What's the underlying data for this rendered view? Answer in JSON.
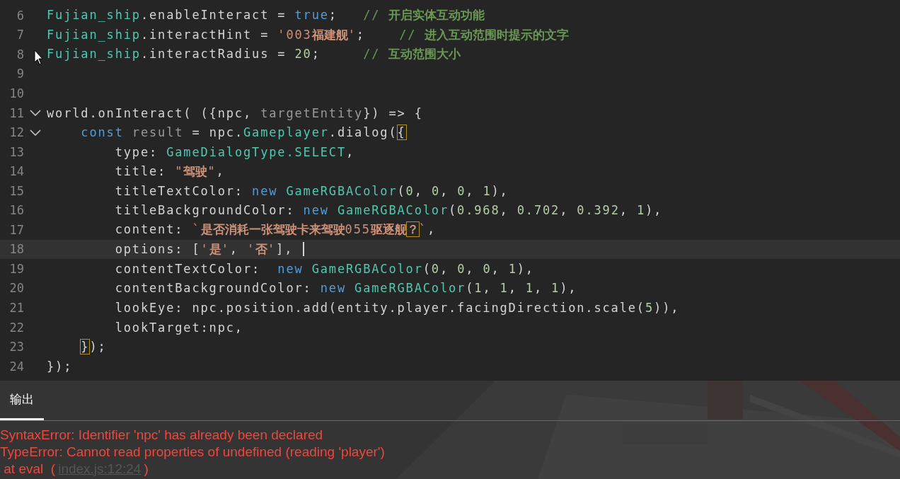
{
  "editor": {
    "lines": [
      {
        "number": "6",
        "fold": false,
        "current": false,
        "tokens": [
          {
            "t": "Fujian_ship",
            "kind": "type"
          },
          {
            "t": ".enableInteract = ",
            "kind": "plain"
          },
          {
            "t": "true",
            "kind": "keyword"
          },
          {
            "t": ";   ",
            "kind": "plain"
          },
          {
            "t": "// ",
            "kind": "comment"
          },
          {
            "t": "开启实体互动功能",
            "kind": "comment-cjk"
          }
        ]
      },
      {
        "number": "7",
        "fold": false,
        "current": false,
        "tokens": [
          {
            "t": "Fujian_ship",
            "kind": "type"
          },
          {
            "t": ".interactHint = ",
            "kind": "plain"
          },
          {
            "t": "'003",
            "kind": "string"
          },
          {
            "t": "福建舰",
            "kind": "string-cjk"
          },
          {
            "t": "'",
            "kind": "string"
          },
          {
            "t": ";    ",
            "kind": "plain"
          },
          {
            "t": "// ",
            "kind": "comment"
          },
          {
            "t": "进入互动范围时提示的文字",
            "kind": "comment-cjk"
          }
        ]
      },
      {
        "number": "8",
        "fold": false,
        "current": false,
        "tokens": [
          {
            "t": "Fujian_ship",
            "kind": "type"
          },
          {
            "t": ".interactRadius = ",
            "kind": "plain"
          },
          {
            "t": "20",
            "kind": "number"
          },
          {
            "t": ";     ",
            "kind": "plain"
          },
          {
            "t": "// ",
            "kind": "comment"
          },
          {
            "t": "互动范围大小",
            "kind": "comment-cjk"
          }
        ]
      },
      {
        "number": "9",
        "fold": false,
        "current": false
      },
      {
        "number": "10",
        "fold": false,
        "current": false
      },
      {
        "number": "11",
        "fold": true,
        "current": false,
        "tokens": [
          {
            "t": "world.onInteract( ({npc, ",
            "kind": "plain"
          },
          {
            "t": "targetEntity",
            "kind": "dim"
          },
          {
            "t": "}) => {",
            "kind": "plain"
          }
        ]
      },
      {
        "number": "12",
        "fold": true,
        "current": false,
        "tokens": [
          {
            "t": "    const",
            "kind": "keyword"
          },
          {
            "t": " result",
            "kind": "dim"
          },
          {
            "t": " = npc.",
            "kind": "plain"
          },
          {
            "t": "Gameplayer",
            "kind": "type"
          },
          {
            "t": ".dialog(",
            "kind": "plain"
          },
          {
            "t": "{",
            "kind": "plain",
            "boxed": true
          }
        ]
      },
      {
        "number": "13",
        "fold": false,
        "current": false,
        "tokens": [
          {
            "t": "        type: ",
            "kind": "plain"
          },
          {
            "t": "GameDialogType.SELECT",
            "kind": "type"
          },
          {
            "t": ",",
            "kind": "plain"
          }
        ]
      },
      {
        "number": "14",
        "fold": false,
        "current": false,
        "tokens": [
          {
            "t": "        title: ",
            "kind": "plain"
          },
          {
            "t": "\"",
            "kind": "string"
          },
          {
            "t": "驾驶",
            "kind": "string-cjk"
          },
          {
            "t": "\"",
            "kind": "string"
          },
          {
            "t": ",",
            "kind": "plain"
          }
        ]
      },
      {
        "number": "15",
        "fold": false,
        "current": false,
        "tokens": [
          {
            "t": "        titleTextColor: ",
            "kind": "plain"
          },
          {
            "t": "new",
            "kind": "keyword"
          },
          {
            "t": " GameRGBAColor",
            "kind": "type"
          },
          {
            "t": "(",
            "kind": "plain"
          },
          {
            "t": "0",
            "kind": "number"
          },
          {
            "t": ", ",
            "kind": "plain"
          },
          {
            "t": "0",
            "kind": "number"
          },
          {
            "t": ", ",
            "kind": "plain"
          },
          {
            "t": "0",
            "kind": "number"
          },
          {
            "t": ", ",
            "kind": "plain"
          },
          {
            "t": "1",
            "kind": "number"
          },
          {
            "t": "),",
            "kind": "plain"
          }
        ]
      },
      {
        "number": "16",
        "fold": false,
        "current": false,
        "tokens": [
          {
            "t": "        titleBackgroundColor: ",
            "kind": "plain"
          },
          {
            "t": "new",
            "kind": "keyword"
          },
          {
            "t": " GameRGBAColor",
            "kind": "type"
          },
          {
            "t": "(",
            "kind": "plain"
          },
          {
            "t": "0.968",
            "kind": "number"
          },
          {
            "t": ", ",
            "kind": "plain"
          },
          {
            "t": "0.702",
            "kind": "number"
          },
          {
            "t": ", ",
            "kind": "plain"
          },
          {
            "t": "0.392",
            "kind": "number"
          },
          {
            "t": ", ",
            "kind": "plain"
          },
          {
            "t": "1",
            "kind": "number"
          },
          {
            "t": "),",
            "kind": "plain"
          }
        ]
      },
      {
        "number": "17",
        "fold": false,
        "current": false,
        "tokens": [
          {
            "t": "        content: ",
            "kind": "plain"
          },
          {
            "t": "`",
            "kind": "string"
          },
          {
            "t": "是否消耗一张驾驶卡来驾驶",
            "kind": "string-cjk"
          },
          {
            "t": "055",
            "kind": "string"
          },
          {
            "t": "驱逐舰",
            "kind": "string-cjk"
          },
          {
            "t": "？",
            "kind": "string-cjk",
            "boxed": true
          },
          {
            "t": "`",
            "kind": "string"
          },
          {
            "t": ",",
            "kind": "plain"
          }
        ]
      },
      {
        "number": "18",
        "fold": false,
        "current": true,
        "tokens": [
          {
            "t": "        options: [",
            "kind": "plain"
          },
          {
            "t": "'",
            "kind": "string"
          },
          {
            "t": "是",
            "kind": "string-cjk"
          },
          {
            "t": "'",
            "kind": "string"
          },
          {
            "t": ", ",
            "kind": "plain"
          },
          {
            "t": "'",
            "kind": "string"
          },
          {
            "t": "否",
            "kind": "string-cjk"
          },
          {
            "t": "'",
            "kind": "string"
          },
          {
            "t": "], ",
            "kind": "plain"
          }
        ]
      },
      {
        "number": "19",
        "fold": false,
        "current": false,
        "tokens": [
          {
            "t": "        contentTextColor:  ",
            "kind": "plain"
          },
          {
            "t": "new",
            "kind": "keyword"
          },
          {
            "t": " GameRGBAColor",
            "kind": "type"
          },
          {
            "t": "(",
            "kind": "plain"
          },
          {
            "t": "0",
            "kind": "number"
          },
          {
            "t": ", ",
            "kind": "plain"
          },
          {
            "t": "0",
            "kind": "number"
          },
          {
            "t": ", ",
            "kind": "plain"
          },
          {
            "t": "0",
            "kind": "number"
          },
          {
            "t": ", ",
            "kind": "plain"
          },
          {
            "t": "1",
            "kind": "number"
          },
          {
            "t": "),",
            "kind": "plain"
          }
        ]
      },
      {
        "number": "20",
        "fold": false,
        "current": false,
        "tokens": [
          {
            "t": "        contentBackgroundColor: ",
            "kind": "plain"
          },
          {
            "t": "new",
            "kind": "keyword"
          },
          {
            "t": " GameRGBAColor",
            "kind": "type"
          },
          {
            "t": "(",
            "kind": "plain"
          },
          {
            "t": "1",
            "kind": "number"
          },
          {
            "t": ", ",
            "kind": "plain"
          },
          {
            "t": "1",
            "kind": "number"
          },
          {
            "t": ", ",
            "kind": "plain"
          },
          {
            "t": "1",
            "kind": "number"
          },
          {
            "t": ", ",
            "kind": "plain"
          },
          {
            "t": "1",
            "kind": "number"
          },
          {
            "t": "),",
            "kind": "plain"
          }
        ]
      },
      {
        "number": "21",
        "fold": false,
        "current": false,
        "tokens": [
          {
            "t": "        lookEye: npc.position.add(entity.player.facingDirection.scale(",
            "kind": "plain"
          },
          {
            "t": "5",
            "kind": "number"
          },
          {
            "t": ")),",
            "kind": "plain"
          }
        ]
      },
      {
        "number": "22",
        "fold": false,
        "current": false,
        "tokens": [
          {
            "t": "        lookTarget:npc,",
            "kind": "plain"
          }
        ]
      },
      {
        "number": "23",
        "fold": false,
        "current": false,
        "tokens": [
          {
            "t": "    }",
            "kind": "plain",
            "boxed": true
          },
          {
            "t": ");",
            "kind": "plain"
          }
        ]
      },
      {
        "number": "24",
        "fold": false,
        "current": false,
        "tokens": [
          {
            "t": "});",
            "kind": "plain"
          }
        ]
      }
    ]
  },
  "output": {
    "tab": {
      "label": "输出",
      "selected": true
    },
    "lines": [
      {
        "text": "SyntaxError: Identifier 'npc' has already been declared"
      },
      {
        "text": "TypeError: Cannot read properties of undefined (reading 'player')"
      },
      {
        "text": " at eval  (",
        "link": "index.js:12:24",
        "after": ")"
      }
    ]
  }
}
